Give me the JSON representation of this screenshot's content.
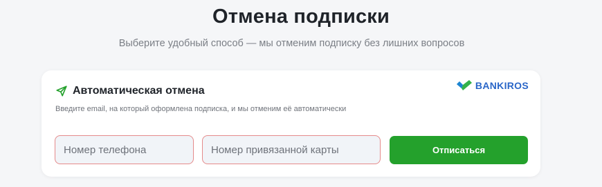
{
  "page": {
    "title": "Отмена подписки",
    "subtitle": "Выберите удобный способ — мы отменим подписку без лишних вопросов"
  },
  "card": {
    "title": "Автоматическая отмена",
    "description": "Введите email, на который оформлена подписка, и мы отменим её автоматически",
    "title_icon": "send-icon",
    "brand": {
      "name": "BANKIROS",
      "logo_icon": "checkmark-logo-icon"
    },
    "phone_input": {
      "value": "",
      "placeholder": "Номер телефона"
    },
    "card_input": {
      "value": "",
      "placeholder": "Номер привязанной карты"
    },
    "submit_label": "Отписаться"
  },
  "colors": {
    "accent_green": "#24a12c",
    "brand_blue": "#2a66c8",
    "input_border_error": "#e58a8a"
  }
}
